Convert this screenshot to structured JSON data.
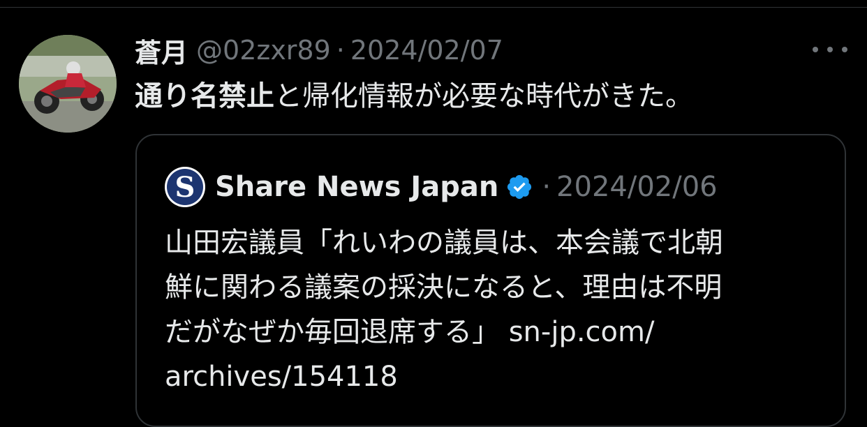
{
  "tweet": {
    "display_name": "蒼月",
    "handle": "@02zxr89",
    "separator": "·",
    "date": "2024/02/07",
    "avatar_icon": "motorcycle-rider-photo",
    "more_icon": "more-dots-icon",
    "text_bold": "通り名禁止",
    "text_rest": "と帰化情報が必要な時代がきた。"
  },
  "quote": {
    "logo_letter": "S",
    "source_name": "Share News Japan",
    "verified_icon": "verified-badge-icon",
    "separator": "·",
    "date": "2024/02/06",
    "body_lines": [
      "山田宏議員「れいわの議員は、本会議で北朝",
      "鮮に関わる議案の採決になると、理由は不明",
      "だがなぜか毎回退席する」 sn-jp.com/",
      "archives/154118"
    ]
  },
  "colors": {
    "background": "#000000",
    "text_primary": "#e7e9ea",
    "text_secondary": "#71767b",
    "border": "#2f3336",
    "verified_blue": "#1d9bf0",
    "logo_navy": "#1d3570"
  }
}
